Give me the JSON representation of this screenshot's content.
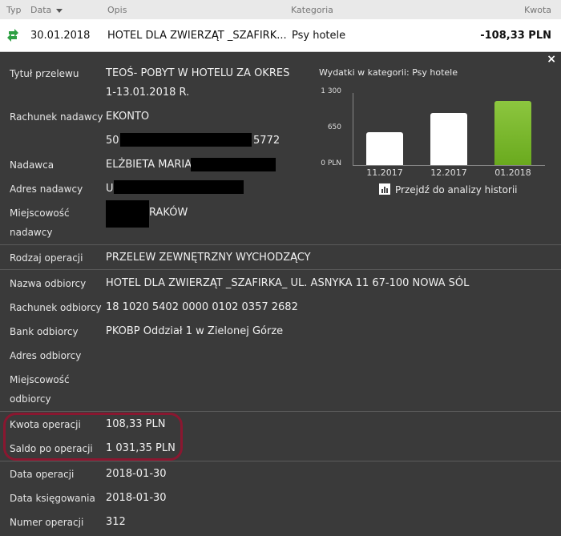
{
  "header": {
    "col_type": "Typ",
    "col_date": "Data",
    "col_desc": "Opis",
    "col_category": "Kategoria",
    "col_amount": "Kwota"
  },
  "transaction": {
    "date": "30.01.2018",
    "description": "HOTEL DLA ZWIERZĄT _SZAFIRK...",
    "category": "Psy hotele",
    "amount": "-108,33 PLN"
  },
  "details": {
    "close_icon": "×",
    "title_label": "Tytuł przelewu",
    "title_value_1": "TEOŚ- POBYT W HOTELU ZA OKRES",
    "title_value_2": "1-13.01.2018 R.",
    "sender_account_label": "Rachunek nadawcy",
    "sender_account_name": "EKONTO",
    "sender_account_prefix": "50",
    "sender_account_suffix": "5772",
    "sender_label": "Nadawca",
    "sender_value": "ELŻBIETA MARIA I",
    "sender_address_label": "Adres nadawcy",
    "sender_address_value": "U",
    "sender_city_label_1": "Miejscowość",
    "sender_city_label_2": "nadawcy",
    "sender_city_value": "RAKÓW",
    "op_type_label": "Rodzaj operacji",
    "op_type_value": "PRZELEW ZEWNĘTRZNY WYCHODZĄCY",
    "recipient_name_label": "Nazwa odbiorcy",
    "recipient_name_value": "HOTEL DLA ZWIERZĄT _SZAFIRKA_ UL. ASNYKA 11 67-100 NOWA SÓL",
    "recipient_account_label": "Rachunek odbiorcy",
    "recipient_account_value": "18 1020 5402 0000 0102 0357 2682",
    "recipient_bank_label": "Bank odbiorcy",
    "recipient_bank_value": "PKOBP Oddział 1 w Zielonej Górze",
    "recipient_address_label": "Adres odbiorcy",
    "recipient_city_label_1": "Miejscowość",
    "recipient_city_label_2": "odbiorcy",
    "amount_label": "Kwota operacji",
    "amount_value": "108,33 PLN",
    "balance_label": "Saldo po operacji",
    "balance_value": "1 031,35 PLN",
    "op_date_label": "Data operacji",
    "op_date_value": "2018-01-30",
    "posting_date_label": "Data księgowania",
    "posting_date_value": "2018-01-30",
    "op_number_label": "Numer operacji",
    "op_number_value": "312"
  },
  "history_link": "Przejdź do analizy historii",
  "colors": {
    "bar_default": "#ffffff",
    "bar_current": "#6aaa1e",
    "highlight": "#8a1730"
  },
  "chart_data": {
    "type": "bar",
    "title": "Wydatki w kategorii:  Psy hotele",
    "categories": [
      "11.2017",
      "12.2017",
      "01.2018"
    ],
    "values": [
      590,
      940,
      1150
    ],
    "ylim": [
      0,
      1300
    ],
    "yticks": [
      "0 PLN",
      "650",
      "1 300"
    ],
    "highlighted_category": "01.2018"
  }
}
